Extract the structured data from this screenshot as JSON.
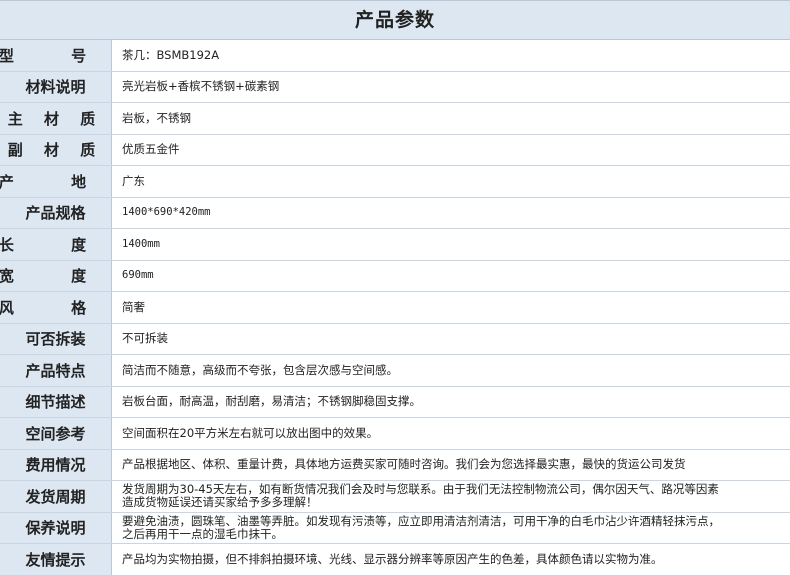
{
  "title": "产品参数",
  "rows": [
    {
      "label": "型  号",
      "value": "茶几：BSMB192A"
    },
    {
      "label": "材料说明",
      "value": "亮光岩板+香槟不锈钢+碳素钢"
    },
    {
      "label": "主 材 质",
      "value": "岩板，不锈钢"
    },
    {
      "label": "副 材 质",
      "value": "优质五金件"
    },
    {
      "label": "产  地",
      "value": "广东"
    },
    {
      "label": "产品规格",
      "value": "1400*690*420mm"
    },
    {
      "label": "长  度",
      "value": "1400mm"
    },
    {
      "label": "宽  度",
      "value": "690mm"
    },
    {
      "label": "风  格",
      "value": "简奢"
    },
    {
      "label": "可否拆装",
      "value": "不可拆装"
    },
    {
      "label": "产品特点",
      "value": "简洁而不随意，高级而不夸张，包含层次感与空间感。"
    },
    {
      "label": "细节描述",
      "value": "岩板台面，耐高温，耐刮磨，易清洁；不锈钢脚稳固支撑。"
    },
    {
      "label": "空间参考",
      "value": "空间面积在20平方米左右就可以放出图中的效果。"
    },
    {
      "label": "费用情况",
      "value": "产品根据地区、体积、重量计费，具体地方运费买家可随时咨询。我们会为您选择最实惠，最快的货运公司发货"
    },
    {
      "label": "发货周期",
      "value": "发货周期为30-45天左右，如有断货情况我们会及时与您联系。由于我们无法控制物流公司，偶尔因天气、路况等因素\n造成货物延误还请买家给予多多理解！"
    },
    {
      "label": "保养说明",
      "value": "要避免油渍，圆珠笔、油墨等弄脏。如发现有污渍等，应立即用清洁剂清洁，可用干净的白毛巾沾少许酒精轻抹污点，\n之后再用干一点的湿毛巾抹干。"
    },
    {
      "label": "友情提示",
      "value": "产品均为实物拍摄，但不排斜拍摄环境、光线、显示器分辨率等原因产生的色差，具体颜色请以实物为准。"
    }
  ]
}
